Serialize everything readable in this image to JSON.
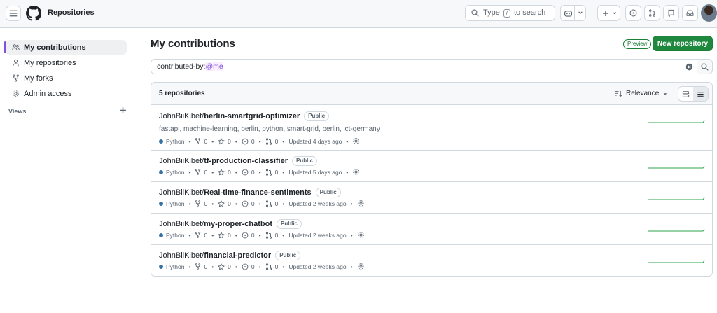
{
  "header": {
    "context": "Repositories",
    "search_prefix": "Type",
    "search_slash": "/",
    "search_suffix": "to search"
  },
  "sidebar": {
    "items": [
      {
        "label": "My contributions",
        "icon": "people-icon"
      },
      {
        "label": "My repositories",
        "icon": "person-icon"
      },
      {
        "label": "My forks",
        "icon": "fork-icon"
      },
      {
        "label": "Admin access",
        "icon": "gear-icon"
      }
    ],
    "views_label": "Views"
  },
  "main": {
    "title": "My contributions",
    "preview_badge": "Preview",
    "new_repo_label": "New repository",
    "filter_prefix": "contributed-by:",
    "filter_me": "@me",
    "count": "5 repositories",
    "sort_label": "Relevance"
  },
  "repos": [
    {
      "owner": "JohnBiiKibet/",
      "name": "berlin-smartgrid-optimizer",
      "visibility": "Public",
      "description": "fastapi, machine-learning, berlin, python, smart-grid, berlin, ict-germany",
      "language": "Python",
      "forks": "0",
      "stars": "0",
      "issues": "0",
      "prs": "0",
      "updated": "Updated 4 days ago"
    },
    {
      "owner": "JohnBiiKibet/",
      "name": "tf-production-classifier",
      "visibility": "Public",
      "description": "",
      "language": "Python",
      "forks": "0",
      "stars": "0",
      "issues": "0",
      "prs": "0",
      "updated": "Updated 5 days ago"
    },
    {
      "owner": "JohnBiiKibet/",
      "name": "Real-time-finance-sentiments",
      "visibility": "Public",
      "description": "",
      "language": "Python",
      "forks": "0",
      "stars": "0",
      "issues": "0",
      "prs": "0",
      "updated": "Updated 2 weeks ago"
    },
    {
      "owner": "JohnBiiKibet/",
      "name": "my-proper-chatbot",
      "visibility": "Public",
      "description": "",
      "language": "Python",
      "forks": "0",
      "stars": "0",
      "issues": "0",
      "prs": "0",
      "updated": "Updated 2 weeks ago"
    },
    {
      "owner": "JohnBiiKibet/",
      "name": "financial-predictor",
      "visibility": "Public",
      "description": "",
      "language": "Python",
      "forks": "0",
      "stars": "0",
      "issues": "0",
      "prs": "0",
      "updated": "Updated 2 weeks ago"
    }
  ],
  "colors": {
    "accent": "#8250df",
    "primary_button": "#1f883d",
    "python": "#3572A5",
    "sparkline": "#2da44e"
  }
}
